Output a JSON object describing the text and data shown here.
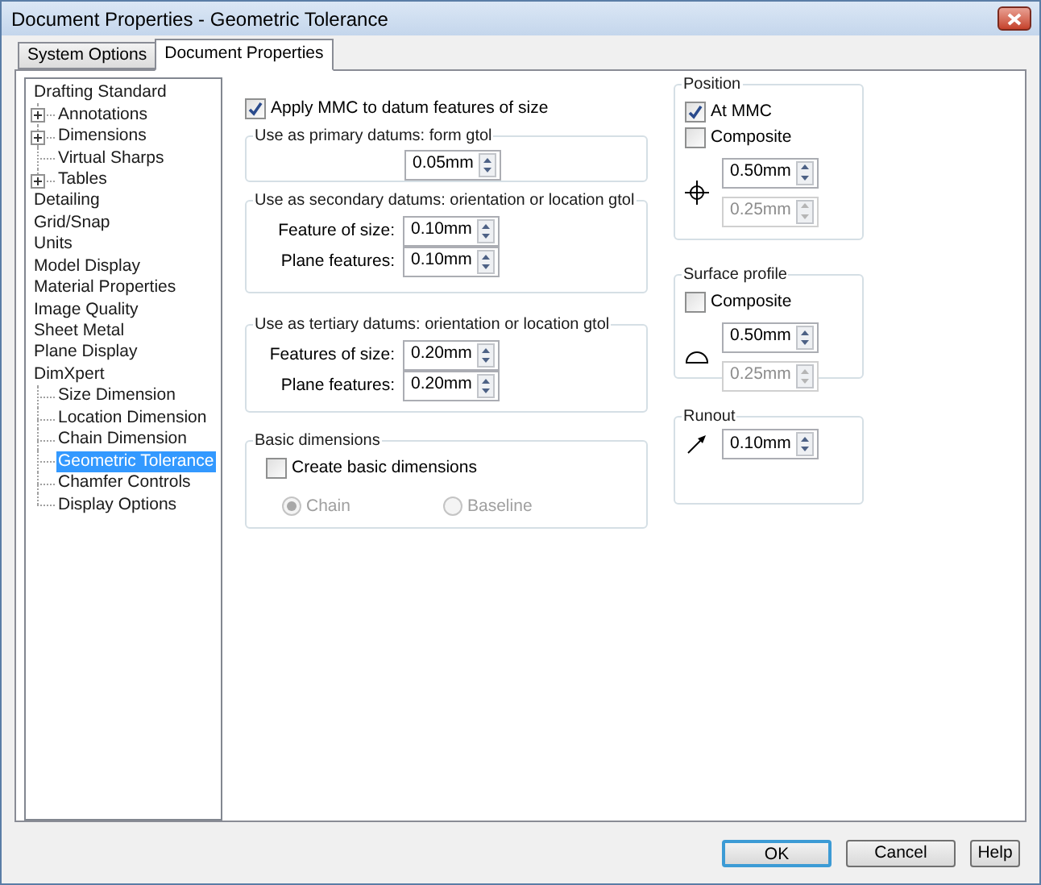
{
  "window": {
    "title": "Document Properties - Geometric Tolerance"
  },
  "tabs": [
    {
      "label": "System Options",
      "selected": false
    },
    {
      "label": "Document Properties",
      "selected": true
    }
  ],
  "tree": [
    {
      "label": "Drafting Standard",
      "selected": false,
      "children": [
        {
          "label": "Annotations",
          "expanded": false,
          "selected": false
        },
        {
          "label": "Dimensions",
          "expanded": false,
          "selected": false
        },
        {
          "label": "Virtual Sharps",
          "selected": false
        },
        {
          "label": "Tables",
          "expanded": false,
          "selected": false
        }
      ]
    },
    {
      "label": "Detailing",
      "selected": false
    },
    {
      "label": "Grid/Snap",
      "selected": false
    },
    {
      "label": "Units",
      "selected": false
    },
    {
      "label": "Model Display",
      "selected": false
    },
    {
      "label": "Material Properties",
      "selected": false
    },
    {
      "label": "Image Quality",
      "selected": false
    },
    {
      "label": "Sheet Metal",
      "selected": false
    },
    {
      "label": "Plane Display",
      "selected": false
    },
    {
      "label": "DimXpert",
      "selected": false,
      "children": [
        {
          "label": "Size Dimension",
          "selected": false
        },
        {
          "label": "Location Dimension",
          "selected": false
        },
        {
          "label": "Chain Dimension",
          "selected": false
        },
        {
          "label": "Geometric Tolerance",
          "selected": true
        },
        {
          "label": "Chamfer Controls",
          "selected": false
        },
        {
          "label": "Display Options",
          "selected": false
        }
      ]
    }
  ],
  "apply_mmc": {
    "label": "Apply MMC to datum features of size",
    "checked": true
  },
  "primary": {
    "title": "Use as primary datums: form gtol",
    "value": "0.05mm"
  },
  "secondary": {
    "title": "Use as secondary datums: orientation or location gtol",
    "fields": [
      {
        "label": "Feature of size:",
        "value": "0.10mm"
      },
      {
        "label": "Plane features:",
        "value": "0.10mm"
      }
    ]
  },
  "tertiary": {
    "title": "Use as tertiary datums: orientation or location gtol",
    "fields": [
      {
        "label": "Features of size:",
        "value": "0.20mm"
      },
      {
        "label": "Plane features:",
        "value": "0.20mm"
      }
    ]
  },
  "basic_dimensions": {
    "title": "Basic dimensions",
    "checkbox": {
      "label": "Create basic dimensions",
      "checked": false
    },
    "options": [
      {
        "label": "Chain",
        "selected": true,
        "disabled": true
      },
      {
        "label": "Baseline",
        "selected": false,
        "disabled": true
      }
    ]
  },
  "position": {
    "title": "Position",
    "checkboxes": [
      {
        "label": "At MMC",
        "checked": true
      },
      {
        "label": "Composite",
        "checked": false
      }
    ],
    "values": [
      {
        "value": "0.50mm",
        "disabled": false
      },
      {
        "value": "0.25mm",
        "disabled": true
      }
    ]
  },
  "surface_profile": {
    "title": "Surface profile",
    "checkboxes": [
      {
        "label": "Composite",
        "checked": false
      }
    ],
    "values": [
      {
        "value": "0.50mm",
        "disabled": false
      },
      {
        "value": "0.25mm",
        "disabled": true
      }
    ]
  },
  "runout": {
    "title": "Runout",
    "values": [
      {
        "value": "0.10mm",
        "disabled": false
      }
    ]
  },
  "buttons": [
    {
      "label": "OK",
      "default": true
    },
    {
      "label": "Cancel",
      "default": false
    },
    {
      "label": "Help",
      "default": false
    }
  ]
}
